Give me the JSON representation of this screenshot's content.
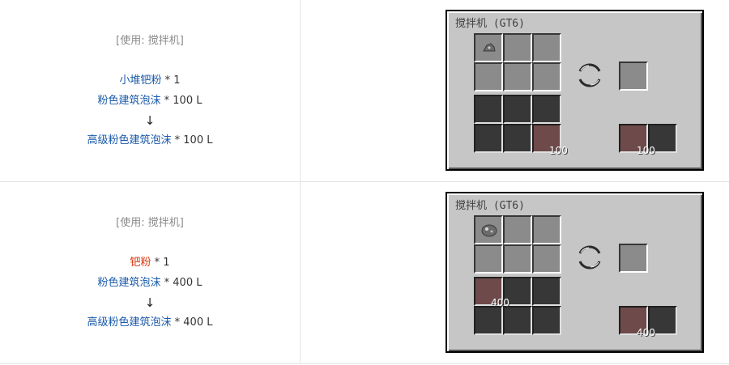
{
  "recipes": [
    {
      "usage": "[使用: 搅拌机]",
      "input_item": {
        "name": "小堆钯粉",
        "qty": "* 1"
      },
      "input_fluid": {
        "name": "粉色建筑泡沫",
        "qty": "* 100 L"
      },
      "arrow": "↓",
      "output_fluid": {
        "name": "高级粉色建筑泡沫",
        "qty": "* 100 L"
      },
      "gui": {
        "title": "搅拌机 (GT6)",
        "input_amount": "100",
        "output_amount": "100"
      }
    },
    {
      "usage": "[使用: 搅拌机]",
      "input_item": {
        "name": "钯粉",
        "qty": "* 1"
      },
      "input_fluid": {
        "name": "粉色建筑泡沫",
        "qty": "* 400 L"
      },
      "arrow": "↓",
      "output_fluid": {
        "name": "高级粉色建筑泡沫",
        "qty": "* 400 L"
      },
      "gui": {
        "title": "搅拌机 (GT6)",
        "input_amount": "400",
        "output_amount": "400"
      }
    }
  ],
  "colors": {
    "item_link": "#1a5aa8",
    "item_link_red": "#d9380f",
    "fluid": "#6e4a4a",
    "gui_bg": "#c6c6c6"
  },
  "icons": {
    "dust": "dust-icon",
    "progress": "mixer-progress-icon"
  }
}
